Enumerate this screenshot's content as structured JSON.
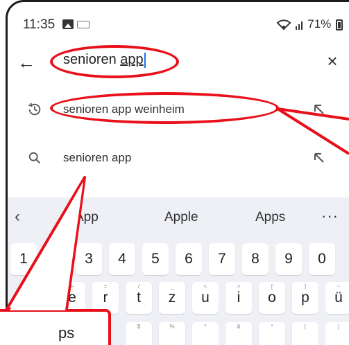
{
  "status_bar": {
    "time": "11:35",
    "signal_battery": "71%"
  },
  "search": {
    "query_plain": "senioren ",
    "query_underlined": "app",
    "close_glyph": "×",
    "back_glyph": "←"
  },
  "suggestions": [
    {
      "type": "history-icon",
      "text": "senioren app weinheim"
    },
    {
      "type": "search-icon",
      "text": "senioren app"
    }
  ],
  "keyboard": {
    "predictions": [
      "App",
      "Apple",
      "Apps"
    ],
    "more_glyph": "···",
    "back_glyph": "‹",
    "number_row": [
      "1",
      "3",
      "4",
      "5",
      "6",
      "7",
      "8",
      "9",
      "0"
    ],
    "letter_row": [
      {
        "key": "e",
        "hint": "÷"
      },
      {
        "key": "r",
        "hint": "="
      },
      {
        "key": "t",
        "hint": "/"
      },
      {
        "key": "z",
        "hint": "_"
      },
      {
        "key": "u",
        "hint": "<"
      },
      {
        "key": "i",
        "hint": ">"
      },
      {
        "key": "o",
        "hint": "["
      },
      {
        "key": "p",
        "hint": "]"
      },
      {
        "key": "ü",
        "hint": "~"
      }
    ],
    "third_row_hints": [
      "$",
      "%",
      "^",
      "&",
      "*",
      "(",
      ")"
    ]
  },
  "annotation": {
    "callout_text": "ps",
    "color": "#e8101a"
  }
}
